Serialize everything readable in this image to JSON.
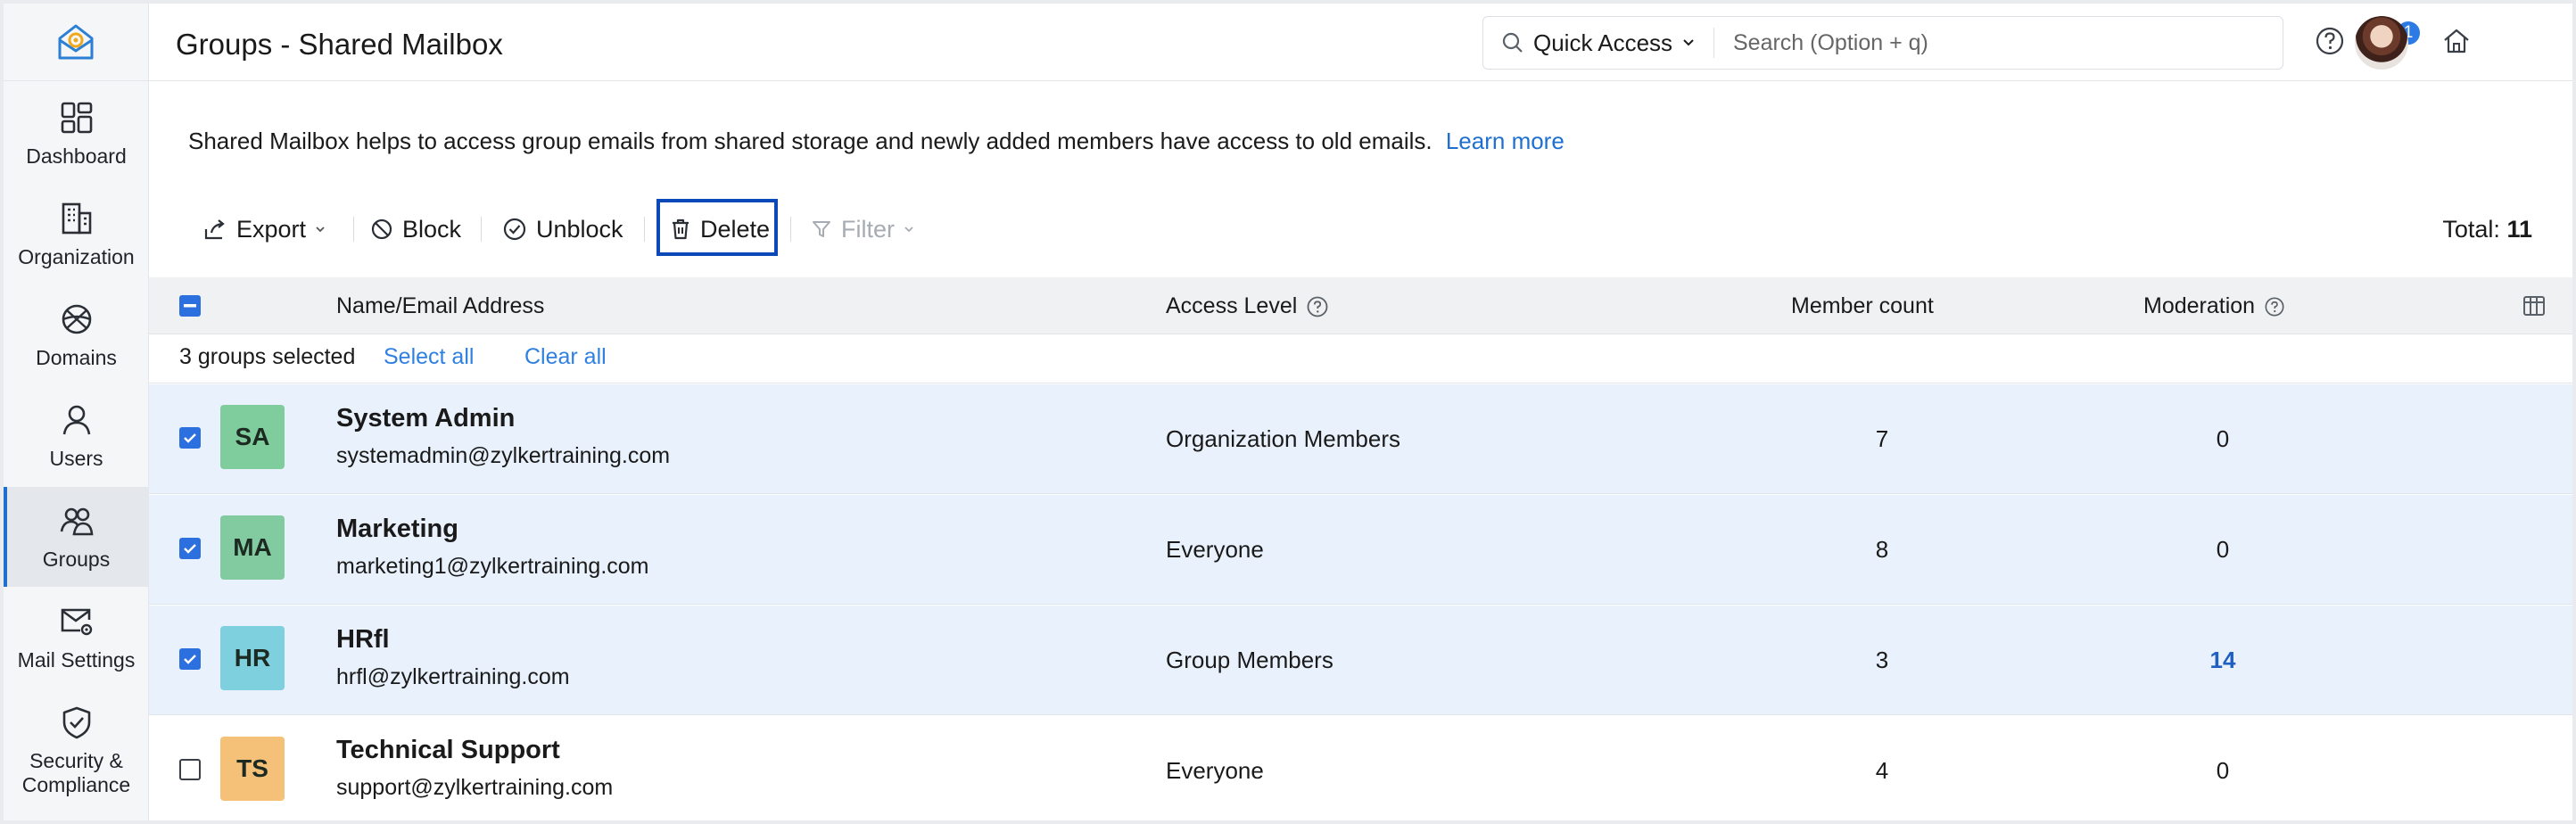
{
  "header": {
    "title": "Groups - Shared Mailbox",
    "quick_access": "Quick Access",
    "search_placeholder": "Search (Option + q)",
    "notification_count": "1"
  },
  "sidebar": {
    "items": [
      {
        "label": "Dashboard",
        "icon": "dashboard-icon"
      },
      {
        "label": "Organization",
        "icon": "building-icon"
      },
      {
        "label": "Domains",
        "icon": "globe-icon"
      },
      {
        "label": "Users",
        "icon": "user-icon"
      },
      {
        "label": "Groups",
        "icon": "groups-icon",
        "active": true
      },
      {
        "label": "Mail Settings",
        "icon": "mail-settings-icon"
      },
      {
        "label": "Security & Compliance",
        "icon": "shield-icon"
      }
    ]
  },
  "info": {
    "text": "Shared Mailbox helps to access group emails from shared storage and newly added members have access to old emails.",
    "link": "Learn more"
  },
  "toolbar": {
    "export": "Export",
    "block": "Block",
    "unblock": "Unblock",
    "delete": "Delete",
    "filter": "Filter",
    "total_label": "Total:",
    "total_value": "11"
  },
  "table": {
    "columns": {
      "name": "Name/Email Address",
      "access": "Access Level",
      "members": "Member count",
      "moderation": "Moderation"
    },
    "selection": {
      "text": "3 groups selected",
      "select_all": "Select all",
      "clear_all": "Clear all"
    },
    "rows": [
      {
        "initials": "SA",
        "name": "System Admin",
        "email": "systemadmin@zylkertraining.com",
        "access": "Organization Members",
        "members": "7",
        "moderation": "0",
        "selected": true,
        "color": "#7fcc9c"
      },
      {
        "initials": "MA",
        "name": "Marketing",
        "email": "marketing1@zylkertraining.com",
        "access": "Everyone",
        "members": "8",
        "moderation": "0",
        "selected": true,
        "color": "#82ca9f"
      },
      {
        "initials": "HR",
        "name": "HRfl",
        "email": "hrfl@zylkertraining.com",
        "access": "Group Members",
        "members": "3",
        "moderation": "14",
        "selected": true,
        "color": "#7fd0df"
      },
      {
        "initials": "TS",
        "name": "Technical Support",
        "email": "support@zylkertraining.com",
        "access": "Everyone",
        "members": "4",
        "moderation": "0",
        "selected": false,
        "color": "#f5c178"
      }
    ]
  },
  "colors": {
    "accent": "#1f6fd1",
    "selected_row": "#e9f1fc",
    "delete_highlight": "#0b49b8"
  }
}
